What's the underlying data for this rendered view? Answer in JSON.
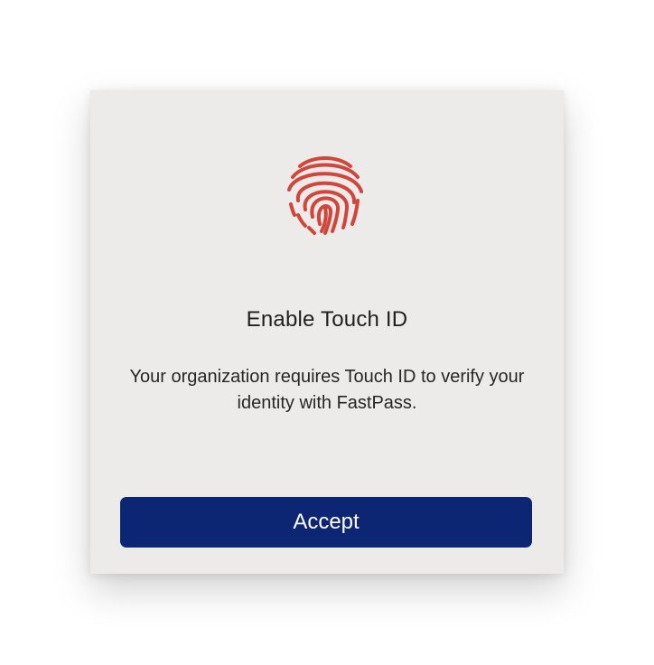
{
  "dialog": {
    "icon": "fingerprint-icon",
    "title": "Enable Touch ID",
    "message": "Your organization requires Touch ID to verify your identity with FastPass.",
    "accept_label": "Accept"
  },
  "colors": {
    "icon_red": "#d1453b",
    "button_bg": "#0d2673",
    "dialog_bg": "#ecebe9"
  }
}
